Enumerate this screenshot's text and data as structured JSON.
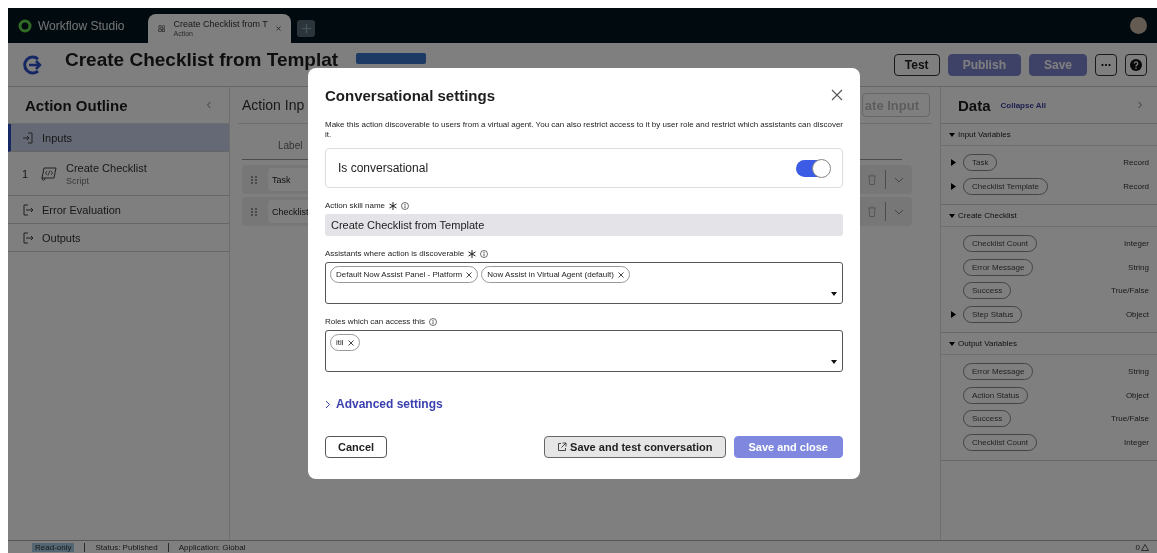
{
  "app_bar": {
    "product": "Workflow Studio",
    "tabs": [
      {
        "title": "Create Checklist from T",
        "subtitle": "Action",
        "selected": true
      }
    ]
  },
  "header": {
    "title": "Create Checklist from Templat",
    "buttons": [
      {
        "label": "Test",
        "disabled": false
      },
      {
        "label": "Publish",
        "disabled": true
      },
      {
        "label": "Save",
        "disabled": true
      }
    ]
  },
  "outline": {
    "title": "Action Outline",
    "items": [
      {
        "kind": "input",
        "label": "Inputs",
        "selected": true
      },
      {
        "kind": "step",
        "number": "1",
        "label": "Create Checklist",
        "sublabel": "Script",
        "selected": false
      },
      {
        "kind": "output",
        "label": "Error Evaluation",
        "selected": false
      },
      {
        "kind": "output",
        "label": "Outputs",
        "selected": false
      }
    ]
  },
  "inputs": {
    "title": "Action Inp",
    "create_label": "ate Input",
    "column": "Label",
    "rows": [
      "Task",
      "Checklist"
    ]
  },
  "data_panel": {
    "title": "Data",
    "collapse_label": "Collapse All",
    "groups": [
      {
        "title": "Input Variables",
        "expanded": true,
        "vars": [
          {
            "name": "Task",
            "type": "Record",
            "expandable": true
          },
          {
            "name": "Checklist Template",
            "type": "Record",
            "expandable": true
          }
        ]
      },
      {
        "title": "Create Checklist",
        "expanded": true,
        "vars": [
          {
            "name": "Checklist Count",
            "type": "Integer",
            "expandable": false
          },
          {
            "name": "Error Message",
            "type": "String",
            "expandable": false
          },
          {
            "name": "Success",
            "type": "True/False",
            "expandable": false
          },
          {
            "name": "Step Status",
            "type": "Object",
            "expandable": true
          }
        ]
      },
      {
        "title": "Output Variables",
        "expanded": true,
        "vars": [
          {
            "name": "Error Message",
            "type": "String",
            "expandable": false
          },
          {
            "name": "Action Status",
            "type": "Object",
            "expandable": false
          },
          {
            "name": "Success",
            "type": "True/False",
            "expandable": false
          },
          {
            "name": "Checklist Count",
            "type": "Integer",
            "expandable": false
          }
        ]
      }
    ]
  },
  "modal": {
    "title": "Conversational settings",
    "description": "Make this action discoverable to users from a virtual agent. You can also restrict access to it by user role and restrict which assistants can discover it.",
    "toggle": {
      "label": "Is conversational",
      "on": true
    },
    "fields": [
      {
        "kind": "text",
        "label": "Action skill name",
        "required": true,
        "value": "Create Checklist from Template"
      },
      {
        "kind": "multi",
        "label": "Assistants where action is discoverable",
        "required": true,
        "chips": [
          "Default Now Assist Panel - Platform",
          "Now Assist in Virtual Agent (default)"
        ]
      },
      {
        "kind": "multi",
        "label": "Roles which can access this",
        "required": false,
        "chips": [
          "itil"
        ]
      }
    ],
    "advanced": {
      "label": "Advanced settings",
      "expanded": false
    },
    "buttons": [
      {
        "kind": "secondary",
        "label": "Cancel",
        "disabled": false
      },
      {
        "kind": "external",
        "label": "Save and test conversation",
        "disabled": false
      },
      {
        "kind": "primary",
        "label": "Save and close",
        "disabled": true
      }
    ]
  },
  "status_bar": {
    "badge": "Read-only",
    "items": [
      "Status: Published",
      "Application: Global"
    ],
    "count": "0"
  }
}
